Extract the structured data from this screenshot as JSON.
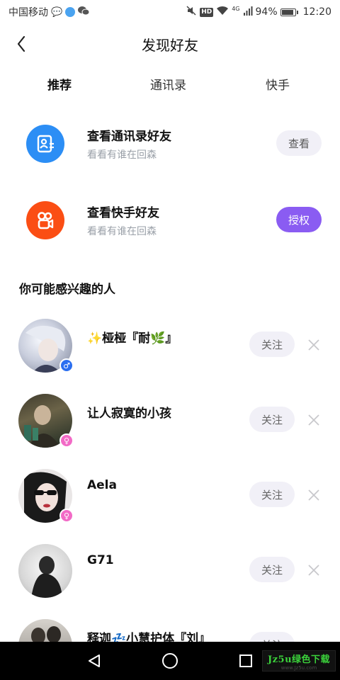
{
  "status_bar": {
    "carrier": "中国移动",
    "signal_type": "4G",
    "battery_percent": "94%",
    "battery_level": 0.94,
    "time": "12:20",
    "hd_label": "HD"
  },
  "header": {
    "title": "发现好友",
    "back_icon": "chevron-left-icon"
  },
  "tabs": [
    {
      "label": "推荐",
      "active": true
    },
    {
      "label": "通讯录",
      "active": false
    },
    {
      "label": "快手",
      "active": false
    }
  ],
  "entries": [
    {
      "title": "查看通讯录好友",
      "subtitle": "看看有谁在回森",
      "button": "查看",
      "icon": "contacts-icon",
      "icon_color": "#2c8ef5",
      "button_style": "light"
    },
    {
      "title": "查看快手好友",
      "subtitle": "看看有谁在回森",
      "button": "授权",
      "icon": "kuaishou-icon",
      "icon_color": "#fb4e14",
      "button_style": "primary"
    }
  ],
  "section_title": "你可能感兴趣的人",
  "people": [
    {
      "name": "✨桠桠『耐🌿』",
      "gender": "male",
      "follow_label": "关注"
    },
    {
      "name": "让人寂寞的小孩",
      "gender": "female",
      "follow_label": "关注"
    },
    {
      "name": "Aela",
      "gender": "female",
      "follow_label": "关注"
    },
    {
      "name": "G71",
      "gender": "none",
      "follow_label": "关注"
    },
    {
      "name": "释迦💤小慧护体『刘』",
      "gender": "none",
      "follow_label": "关注"
    }
  ],
  "watermark": {
    "main": "Jz5u绿色下载",
    "sub": "www.Jz5u.com"
  },
  "colors": {
    "accent": "#8a5cf2",
    "tab_underline": "#ffcf2e",
    "follow_bg": "#f1f0f7"
  }
}
